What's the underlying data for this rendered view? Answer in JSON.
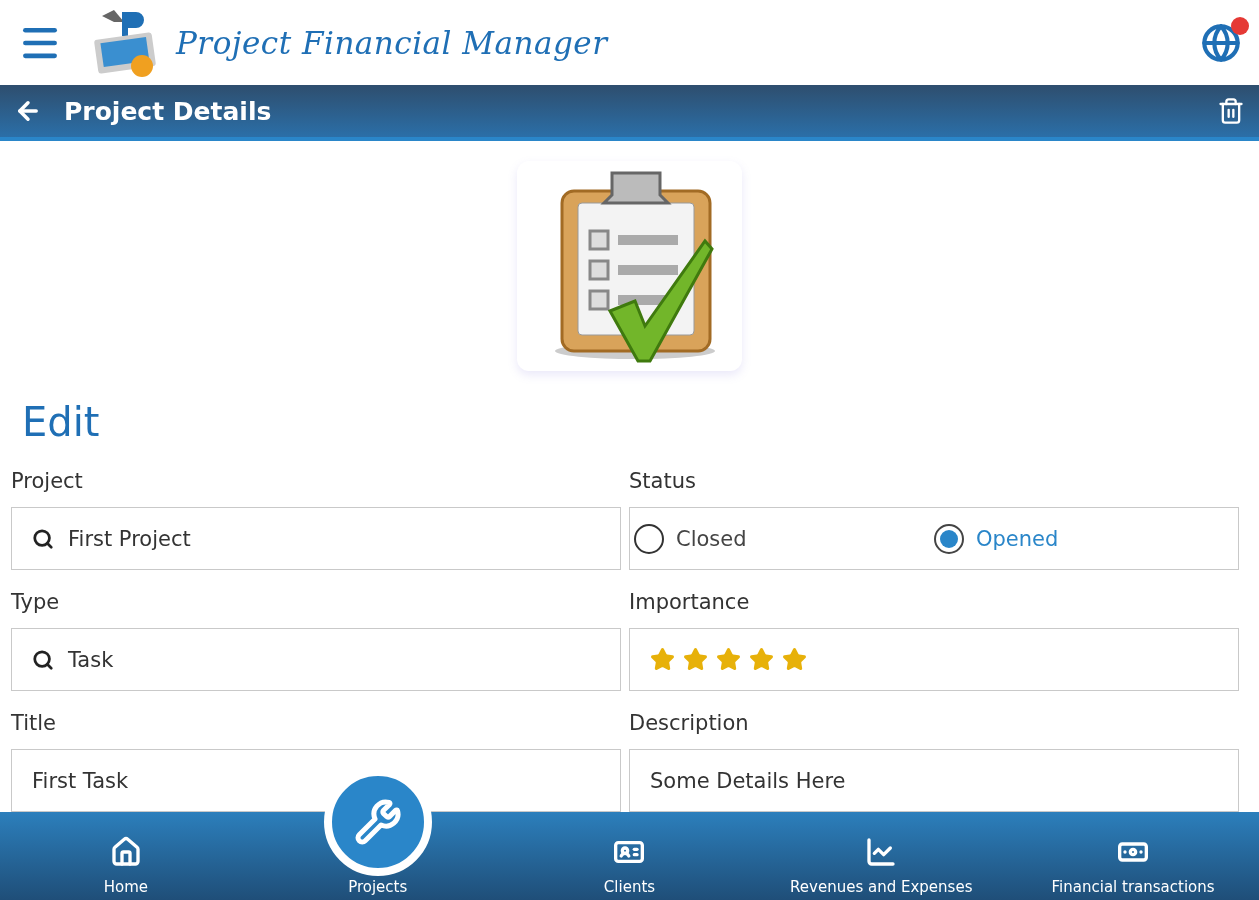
{
  "app": {
    "title": "Project Financial Manager"
  },
  "toolbar": {
    "title": "Project Details"
  },
  "form": {
    "heading": "Edit",
    "fields": [
      {
        "kind": "lookup",
        "label": "Project",
        "value": "First Project"
      },
      {
        "kind": "radio",
        "label": "Status",
        "options": [
          {
            "label": "Closed",
            "selected": false
          },
          {
            "label": "Opened",
            "selected": true
          }
        ]
      },
      {
        "kind": "lookup",
        "label": "Type",
        "value": "Task"
      },
      {
        "kind": "stars",
        "label": "Importance",
        "stars": 5
      },
      {
        "kind": "text",
        "label": "Title",
        "value": "First Task"
      },
      {
        "kind": "text",
        "label": "Description",
        "value": "Some Details Here"
      }
    ]
  },
  "nav": [
    {
      "label": "Home",
      "selected": false
    },
    {
      "label": "Projects",
      "selected": true
    },
    {
      "label": "Clients",
      "selected": false
    },
    {
      "label": "Revenues and Expenses",
      "selected": false
    },
    {
      "label": "Financial transactions",
      "selected": false
    }
  ]
}
